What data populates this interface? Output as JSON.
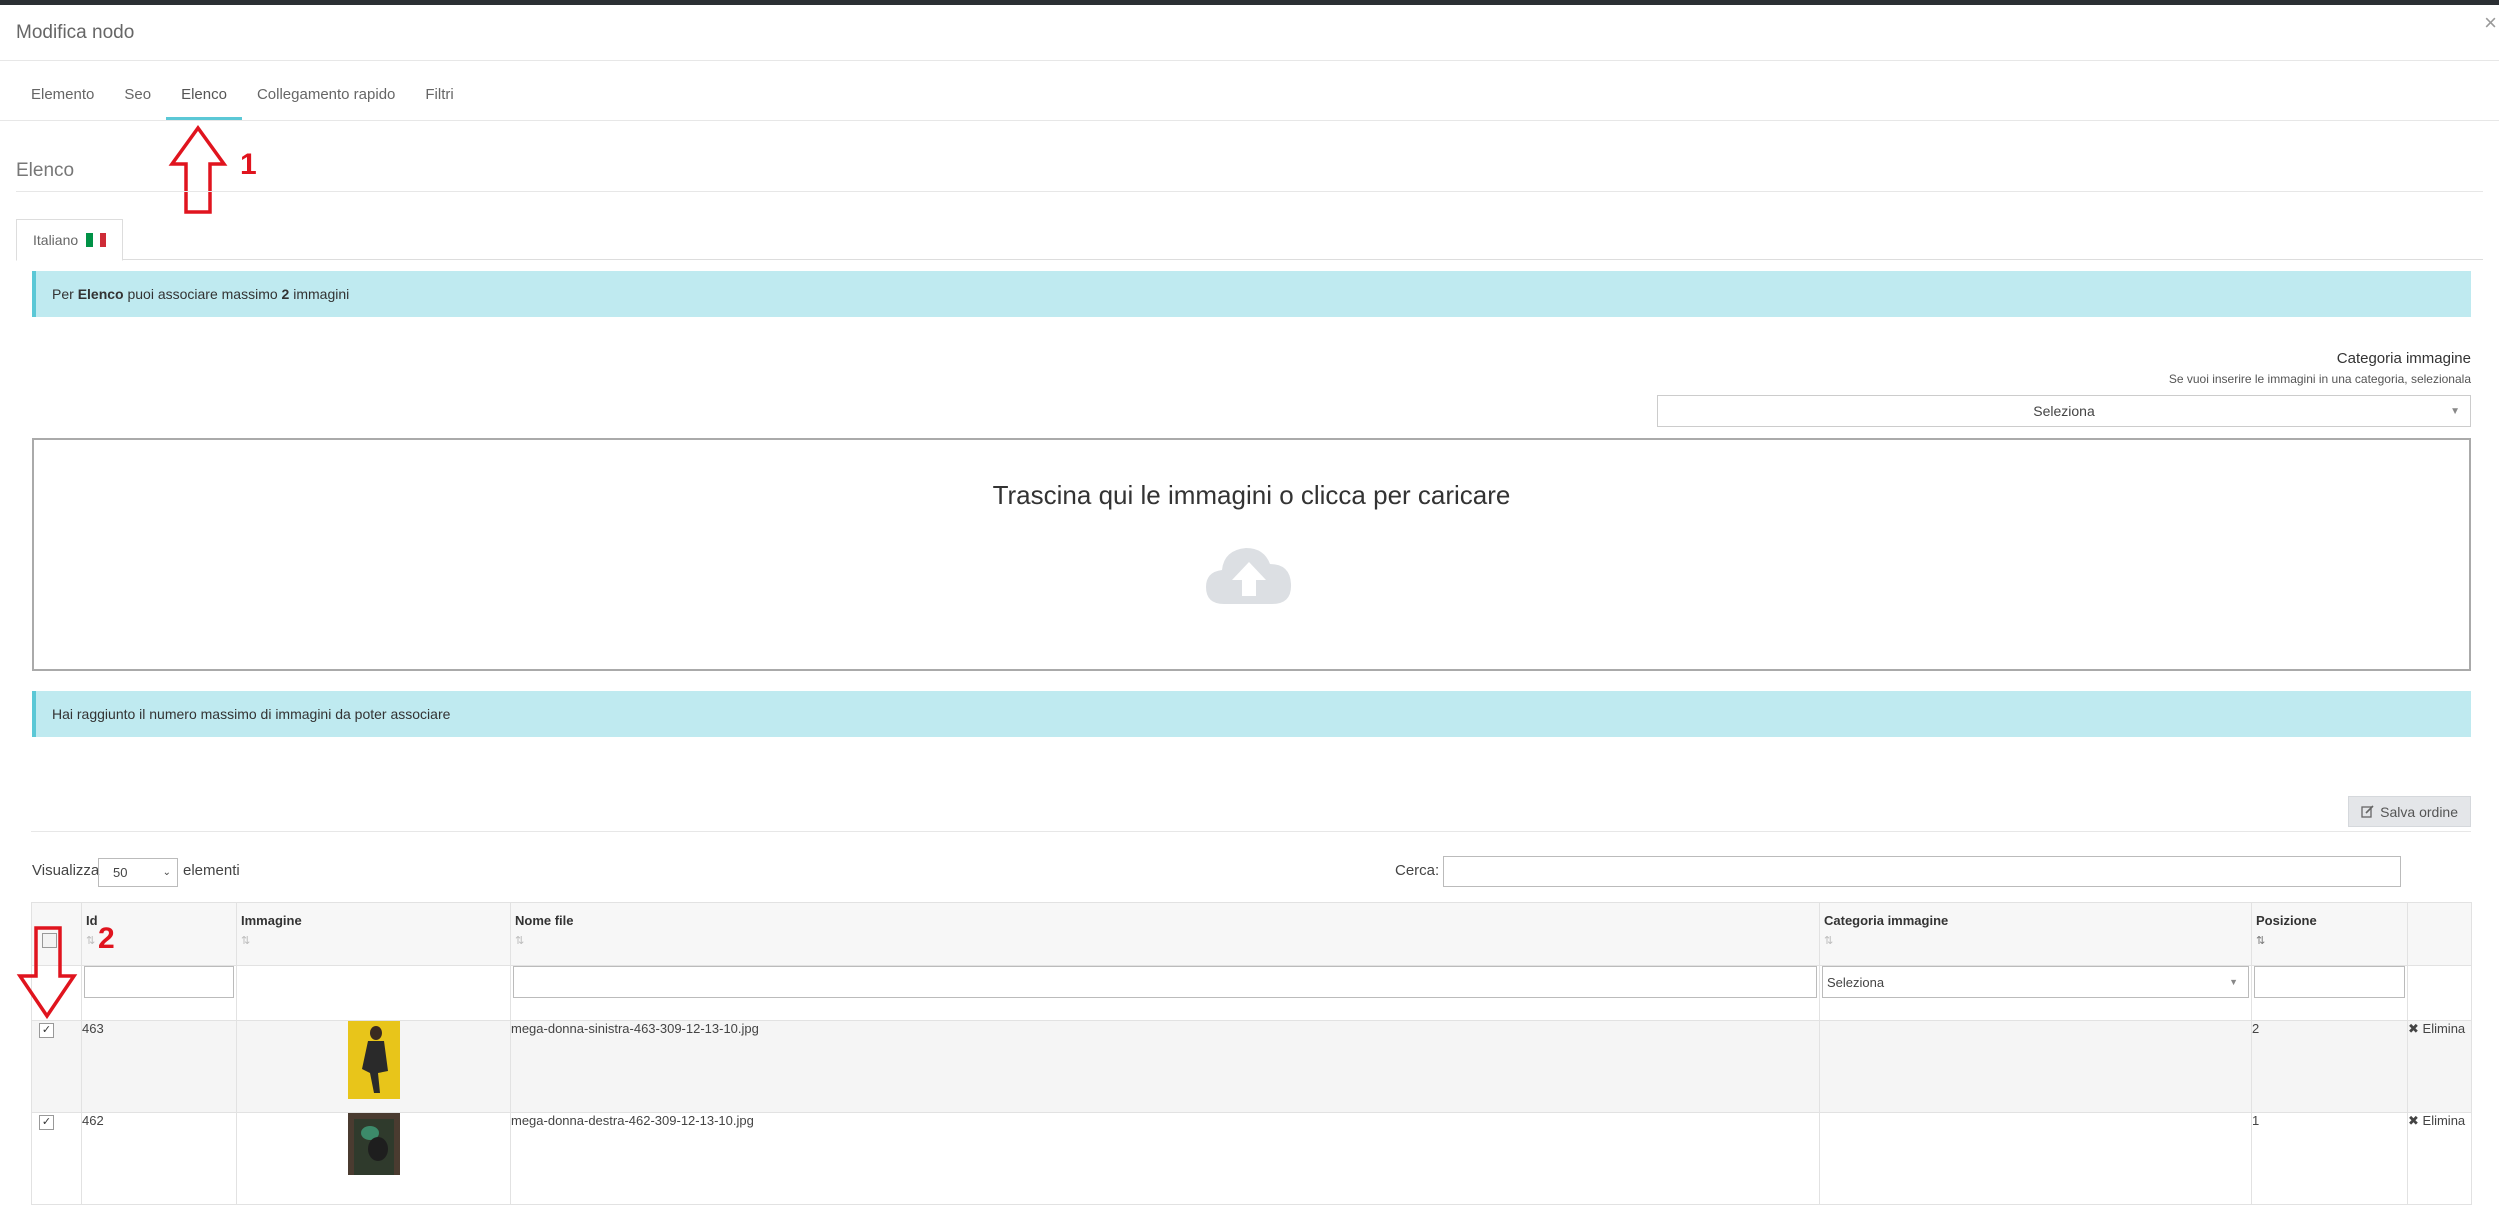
{
  "modal": {
    "title": "Modifica nodo",
    "close_icon": "×"
  },
  "tabs": [
    {
      "label": "Elemento",
      "active": false
    },
    {
      "label": "Seo",
      "active": false
    },
    {
      "label": "Elenco",
      "active": true
    },
    {
      "label": "Collegamento rapido",
      "active": false
    },
    {
      "label": "Filtri",
      "active": false
    }
  ],
  "section": {
    "title": "Elenco"
  },
  "language_tab": {
    "label": "Italiano",
    "flag_colors": [
      "#009246",
      "#ffffff",
      "#ce2b37"
    ]
  },
  "info_alert": {
    "prefix": "Per ",
    "bold_name": "Elenco",
    "middle": " puoi associare massimo ",
    "bold_count": "2",
    "suffix": " immagini"
  },
  "category": {
    "label": "Categoria immagine",
    "help": "Se vuoi inserire le immagini in una categoria, selezionala",
    "select_value": "Seleziona"
  },
  "dropzone": {
    "text": "Trascina qui le immagini o clicca per caricare",
    "icon": "cloud-upload-icon"
  },
  "max_alert": {
    "text": "Hai raggiunto il numero massimo di immagini da poter associare"
  },
  "toolbar": {
    "save_label": "Salva ordine",
    "save_icon": "edit-icon"
  },
  "table_controls": {
    "show_label": "Visualizza",
    "page_size": "50",
    "elements_label": "elementi",
    "search_label": "Cerca:"
  },
  "table": {
    "columns": [
      "Id",
      "Immagine",
      "Nome file",
      "Categoria immagine",
      "Posizione"
    ],
    "filter_select": "Seleziona",
    "delete_label": "Elimina",
    "rows": [
      {
        "id": "463",
        "filename": "mega-donna-sinistra-463-309-12-13-10.jpg",
        "category": "",
        "position": "2",
        "checked": true
      },
      {
        "id": "462",
        "filename": "mega-donna-destra-462-309-12-13-10.jpg",
        "category": "",
        "position": "1",
        "checked": true
      }
    ]
  },
  "annotations": {
    "arrow1_number": "1",
    "arrow2_number": "2",
    "color": "#e0141e"
  },
  "colors": {
    "accent": "#5bc8d6",
    "alert_bg": "#bfeaf0"
  }
}
